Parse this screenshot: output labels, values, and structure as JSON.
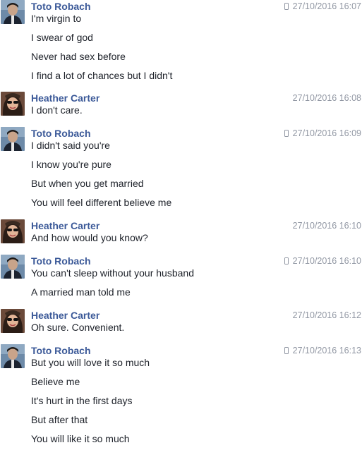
{
  "colors": {
    "sender": "#3b5998",
    "timestamp": "#9197a3",
    "text": "#1d2129"
  },
  "messages": [
    {
      "sender": "Toto Robach",
      "time": "27/10/2016 16:07",
      "mobile": true,
      "lines": [
        "I'm virgin to",
        "I swear of god",
        "Never had sex before",
        "I find a lot of chances but I didn't"
      ]
    },
    {
      "sender": "Heather Carter",
      "time": "27/10/2016 16:08",
      "mobile": false,
      "lines": [
        "I don't care."
      ]
    },
    {
      "sender": "Toto Robach",
      "time": "27/10/2016 16:09",
      "mobile": true,
      "lines": [
        "I didn't said you're",
        "I know you're pure",
        "But when you get married",
        "You will feel different believe me"
      ]
    },
    {
      "sender": "Heather Carter",
      "time": "27/10/2016 16:10",
      "mobile": false,
      "lines": [
        "And how would you know?"
      ]
    },
    {
      "sender": "Toto Robach",
      "time": "27/10/2016 16:10",
      "mobile": true,
      "lines": [
        "You can't sleep without your husband",
        "A married man told me"
      ]
    },
    {
      "sender": "Heather Carter",
      "time": "27/10/2016 16:12",
      "mobile": false,
      "lines": [
        "Oh sure. Convenient."
      ]
    },
    {
      "sender": "Toto Robach",
      "time": "27/10/2016 16:13",
      "mobile": true,
      "lines": [
        "But you will love it so much",
        "Believe me",
        "It's hurt in the first days",
        "But after that",
        "You will like it so much"
      ]
    }
  ]
}
